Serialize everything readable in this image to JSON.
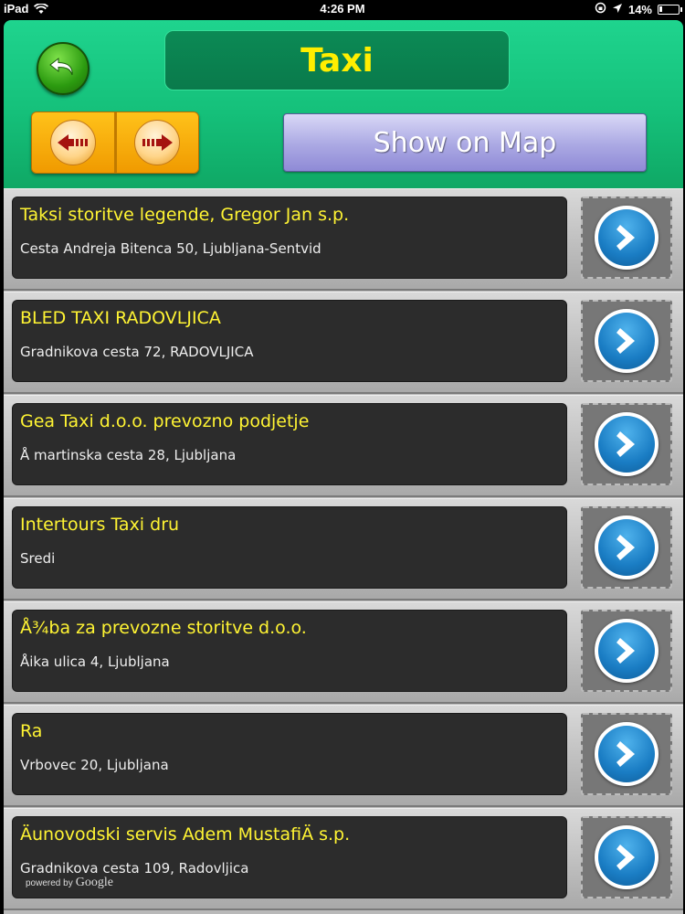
{
  "status_bar": {
    "device": "iPad",
    "time": "4:26 PM",
    "battery": "14%",
    "battery_level": 0.14
  },
  "header": {
    "title": "Taxi",
    "map_button_label": "Show on Map"
  },
  "places": [
    {
      "name": "Taksi storitve legende, Gregor Jan s.p.",
      "address": "Cesta Andreja Bitenca 50, Ljubljana-Sentvid"
    },
    {
      "name": "BLED TAXI RADOVLJICA",
      "address": "Gradnikova cesta 72, RADOVLJICA"
    },
    {
      "name": "Gea Taxi d.o.o. prevozno podjetje",
      "address": "Å martinska cesta 28, Ljubljana"
    },
    {
      "name": "Intertours Taxi dru",
      "address": "Sredi"
    },
    {
      "name": "Å¾ba za prevozne storitve d.o.o.",
      "address": "Åika ulica 4, Ljubljana"
    },
    {
      "name": "Ra",
      "address": "Vrbovec 20, Ljubljana"
    },
    {
      "name": "Äunovodski servis Adem MustafiÄ s.p.",
      "address": "Gradnikova cesta 109, Radovljica"
    }
  ],
  "attribution": {
    "prefix": "powered by",
    "brand": "Google"
  }
}
